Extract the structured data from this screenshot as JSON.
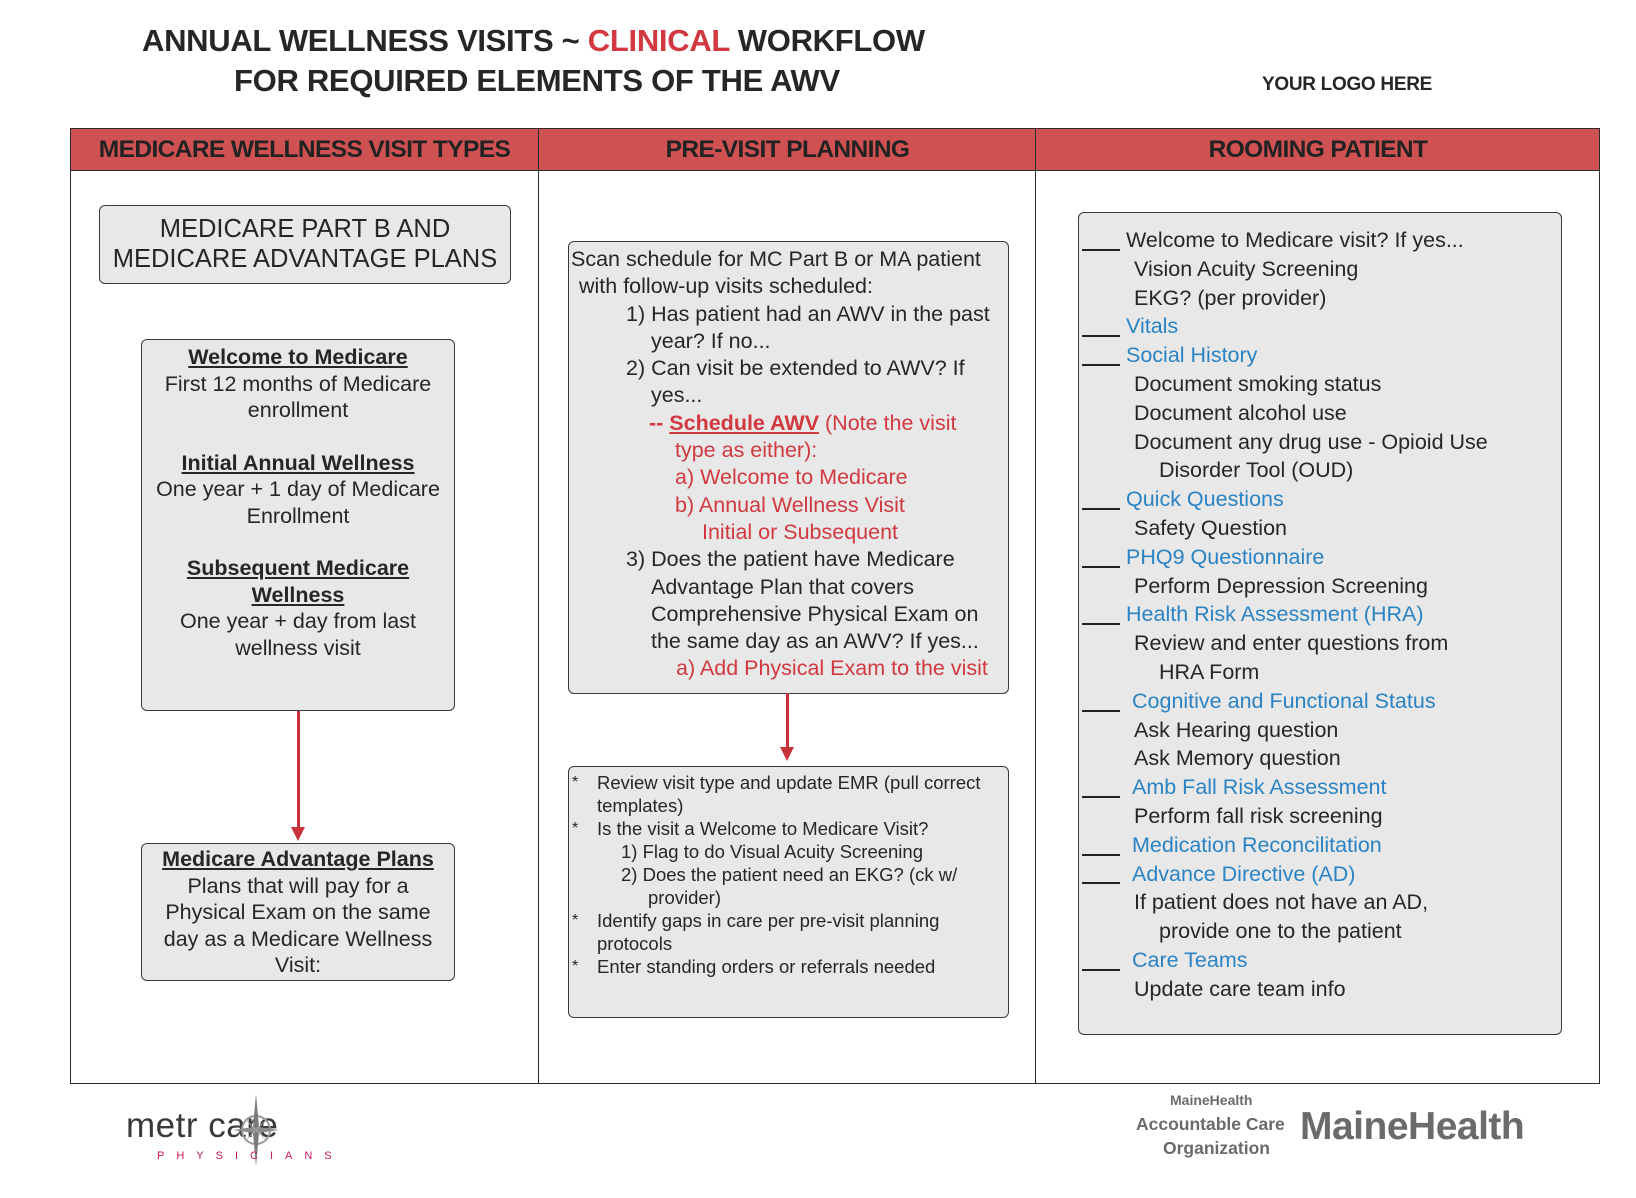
{
  "header": {
    "title_line1_part1": "ANNUAL WELLNESS VISITS ~ ",
    "title_line1_highlight": "CLINICAL",
    "title_line1_part2": " WORKFLOW",
    "title_line2": "FOR REQUIRED ELEMENTS OF THE AWV",
    "logo_placeholder": "YOUR LOGO HERE"
  },
  "colors": {
    "header_band": "#d05152",
    "accent_red": "#d2383f",
    "accent_blue": "#2a83c4",
    "box_fill": "#e8e8e8"
  },
  "columns": [
    {
      "title": "MEDICARE WELLNESS VISIT TYPES"
    },
    {
      "title": "PRE-VISIT PLANNING"
    },
    {
      "title": "ROOMING PATIENT"
    }
  ],
  "visit_types": {
    "plans_box_line1": "MEDICARE PART B AND",
    "plans_box_line2": "MEDICARE ADVANTAGE PLANS",
    "types": [
      {
        "heading": "Welcome to Medicare",
        "desc_line1": "First 12 months of Medicare",
        "desc_line2": "enrollment"
      },
      {
        "heading": "Initial Annual Wellness",
        "desc_line1": "One year + 1 day of Medicare",
        "desc_line2": "Enrollment"
      },
      {
        "heading_line1": "Subsequent Medicare",
        "heading_line2": "Wellness",
        "desc_line1": "One year +  day from last",
        "desc_line2": "wellness visit"
      }
    ],
    "advantage": {
      "heading": "Medicare Advantage Plans",
      "lines": [
        "Plans that will pay for a",
        "Physical Exam on the same",
        "day as a Medicare Wellness",
        "Visit:"
      ]
    }
  },
  "pre_visit": {
    "intro_line1": "Scan schedule for MC Part B or MA patient",
    "intro_line2": "with follow-up visits scheduled:",
    "q1_line1": "1) Has patient had an AWV in the past",
    "q1_line2": "year?  If no...",
    "q2_line1": "2) Can visit be extended to AWV?  If",
    "q2_line2": "yes...",
    "schedule_prefix": "-- ",
    "schedule_link": "Schedule AWV",
    "schedule_suffix": " (Note the visit",
    "schedule_line2": "type as either):",
    "option_a": "a) Welcome to Medicare",
    "option_b": "b) Annual Wellness Visit",
    "option_b_sub": "Initial or Subsequent",
    "q3_line1": "3) Does the patient have Medicare",
    "q3_line2": "Advantage Plan that covers",
    "q3_line3": "Comprehensive Physical Exam on",
    "q3_line4": "the same day as an AWV?  If yes...",
    "q3_action": "a) Add Physical Exam to the visit",
    "bullet_char": "*",
    "checklist": {
      "b1_line1": "Review visit type and update EMR (pull correct",
      "b1_line2": "templates)",
      "b2": "Is the visit a Welcome to Medicare Visit?",
      "b2_sub1": "1) Flag to do Visual Acuity Screening",
      "b2_sub2_line1": "2) Does the patient need an EKG? (ck w/",
      "b2_sub2_line2": "provider)",
      "b3_line1": "Identify gaps in care per pre-visit planning",
      "b3_line2": "protocols",
      "b4": "Enter standing orders or referrals needed"
    }
  },
  "rooming": {
    "items": [
      {
        "text": "Welcome to Medicare visit?  If yes...",
        "checkbox": true,
        "style": "dark"
      },
      {
        "text": "Vision Acuity Screening",
        "checkbox": false,
        "style": "sub"
      },
      {
        "text": "EKG? (per provider)",
        "checkbox": false,
        "style": "sub"
      },
      {
        "text": "Vitals",
        "checkbox": true,
        "style": "blue"
      },
      {
        "text": "Social History",
        "checkbox": true,
        "style": "blue"
      },
      {
        "text": "Document  smoking status",
        "checkbox": false,
        "style": "sub"
      },
      {
        "text": "Document alcohol use",
        "checkbox": false,
        "style": "sub"
      },
      {
        "text": "Document any drug use - Opioid Use",
        "checkbox": false,
        "style": "sub"
      },
      {
        "text": "Disorder Tool (OUD)",
        "checkbox": false,
        "style": "sub2"
      },
      {
        "text": "Quick Questions",
        "checkbox": true,
        "style": "blue"
      },
      {
        "text": "Safety Question",
        "checkbox": false,
        "style": "sub"
      },
      {
        "text": "PHQ9 Questionnaire",
        "checkbox": true,
        "style": "blue"
      },
      {
        "text": "Perform Depression Screening",
        "checkbox": false,
        "style": "sub"
      },
      {
        "text": "Health Risk Assessment (HRA)",
        "checkbox": true,
        "style": "blue"
      },
      {
        "text": "Review and enter questions from",
        "checkbox": false,
        "style": "sub"
      },
      {
        "text": "HRA Form",
        "checkbox": false,
        "style": "sub2"
      },
      {
        "text": "Cognitive and Functional Status",
        "checkbox": true,
        "style": "blue2"
      },
      {
        "text": "Ask Hearing question",
        "checkbox": false,
        "style": "sub"
      },
      {
        "text": "Ask Memory question",
        "checkbox": false,
        "style": "sub"
      },
      {
        "text": "Amb Fall Risk Assessment",
        "checkbox": true,
        "style": "blue2"
      },
      {
        "text": "Perform fall risk screening",
        "checkbox": false,
        "style": "sub"
      },
      {
        "text": "Medication Reconcilitation",
        "checkbox": true,
        "style": "blue2"
      },
      {
        "text": "Advance Directive (AD)",
        "checkbox": true,
        "style": "blue2"
      },
      {
        "text": "If patient does not have an AD,",
        "checkbox": false,
        "style": "sub"
      },
      {
        "text": "provide one to the patient",
        "checkbox": false,
        "style": "sub2"
      },
      {
        "text": "Care Teams",
        "checkbox": true,
        "style": "blue2"
      },
      {
        "text": "Update care team info",
        "checkbox": false,
        "style": "sub"
      }
    ]
  },
  "footer": {
    "metro_word": "metr   care",
    "metro_sub": "PHYSICIANS",
    "mh_aco_line1": "MaineHealth",
    "mh_aco_line2": "Accountable Care",
    "mh_aco_line3": "Organization",
    "mh_big": "MaineHealth"
  }
}
